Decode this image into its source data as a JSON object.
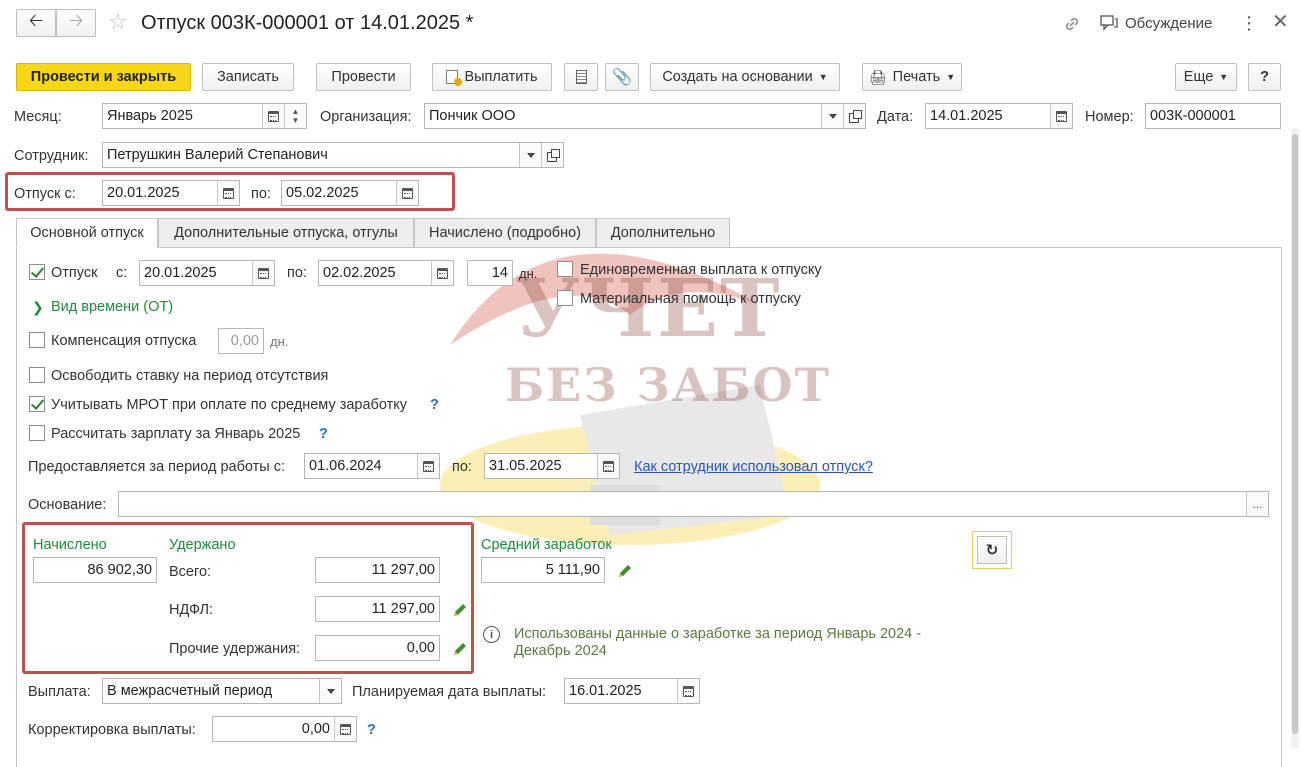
{
  "title": "Отпуск 003К-000001 от 14.01.2025 *",
  "header": {
    "discussion_label": "Обсуждение"
  },
  "toolbar": {
    "post_close": "Провести и закрыть",
    "save": "Записать",
    "post": "Провести",
    "pay": "Выплатить",
    "create_basis": "Создать на основании",
    "print": "Печать",
    "more": "Еще",
    "help": "?"
  },
  "form": {
    "month_label": "Месяц:",
    "month_value": "Январь 2025",
    "org_label": "Организация:",
    "org_value": "Пончик ООО",
    "date_label": "Дата:",
    "date_value": "14.01.2025",
    "number_label": "Номер:",
    "number_value": "003К-000001",
    "employee_label": "Сотрудник:",
    "employee_value": "Петрушкин Валерий Степанович",
    "leave_from_label": "Отпуск с:",
    "leave_from_value": "20.01.2025",
    "leave_to_label": "по:",
    "leave_to_value": "05.02.2025"
  },
  "tabs": [
    {
      "label": "Основной отпуск"
    },
    {
      "label": "Дополнительные отпуска, отгулы"
    },
    {
      "label": "Начислено (подробно)"
    },
    {
      "label": "Дополнительно"
    }
  ],
  "main": {
    "leave_label": "Отпуск",
    "leave_from_label": "с:",
    "leave_from": "20.01.2025",
    "leave_to_label": "по:",
    "leave_to": "02.02.2025",
    "days": "14",
    "days_unit": "дн.",
    "lump_sum": "Единовременная выплата к отпуску",
    "material_aid": "Материальная помощь к отпуску",
    "time_type": "Вид времени (ОТ)",
    "compensation": "Компенсация отпуска",
    "compensation_days": "0,00",
    "compensation_unit": "дн.",
    "release_rate": "Освободить ставку на период отсутствия",
    "mrot": "Учитывать МРОТ при оплате по среднему заработку",
    "calc_salary": "Рассчитать зарплату за Январь 2025",
    "help_q": "?",
    "period_label": "Предоставляется за период работы с:",
    "period_from": "01.06.2024",
    "period_to_label": "по:",
    "period_to": "31.05.2025",
    "usage_link": "Как сотрудник использовал отпуск?",
    "basis_label": "Основание:",
    "basis_value": "",
    "basis_btn": "...",
    "accrued_label": "Начислено",
    "accrued_value": "86 902,30",
    "withheld_label": "Удержано",
    "total_label": "Всего:",
    "total_value": "11 297,00",
    "ndfl_label": "НДФЛ:",
    "ndfl_value": "11 297,00",
    "other_label": "Прочие удержания:",
    "other_value": "0,00",
    "avg_label": "Средний заработок",
    "avg_value": "5 111,90",
    "info_text_1": "Использованы данные о заработке за период Январь 2024 -",
    "info_text_2": "Декабрь 2024",
    "payout_label": "Выплата:",
    "payout_value": "В межрасчетный период",
    "planned_label": "Планируемая дата выплаты:",
    "planned_value": "16.01.2025",
    "correction_label": "Корректировка выплаты:",
    "correction_value": "0,00"
  },
  "watermark": {
    "line1": "УЧЕТ",
    "line2": "БЕЗ ЗАБОТ"
  },
  "colors": {
    "primary_button": "#f7d615",
    "highlight_box": "#c0504d",
    "label_green": "#1f8a3b"
  }
}
